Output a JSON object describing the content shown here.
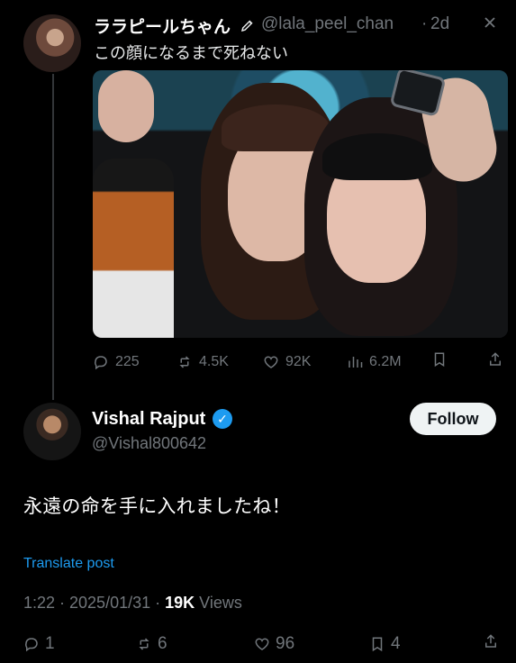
{
  "original_post": {
    "display_name": "ララピールちゃん",
    "handle": "@lala_peel_chan",
    "separator": "·",
    "time": "2d",
    "text": "この顔になるまで死ねない",
    "stats": {
      "replies": "225",
      "reposts": "4.5K",
      "likes": "92K",
      "views": "6.2M"
    }
  },
  "reply_post": {
    "display_name": "Vishal Rajput",
    "handle": "@Vishal800642",
    "follow_label": "Follow",
    "text": "永遠の命を手に入れましたね！",
    "translate_label": "Translate post",
    "meta_prefix": "1:22 · 2025/01/31 · ",
    "views_count": "19K",
    "views_label": " Views",
    "stats": {
      "replies": "1",
      "reposts": "6",
      "likes": "96",
      "bookmarks": "4"
    }
  },
  "icons": {
    "pen_icon": "pen-icon",
    "close_icon": "close-icon",
    "reply_icon": "reply-icon",
    "repost_icon": "repost-icon",
    "like_icon": "like-icon",
    "views_icon": "views-icon",
    "bookmark_icon": "bookmark-icon",
    "share_icon": "share-icon",
    "verified_icon": "verified-icon"
  },
  "colors": {
    "background": "#000000",
    "text": "#e7e9ea",
    "muted": "#71767b",
    "accent": "#1d9bf0",
    "follow_bg": "#eff3f4"
  }
}
